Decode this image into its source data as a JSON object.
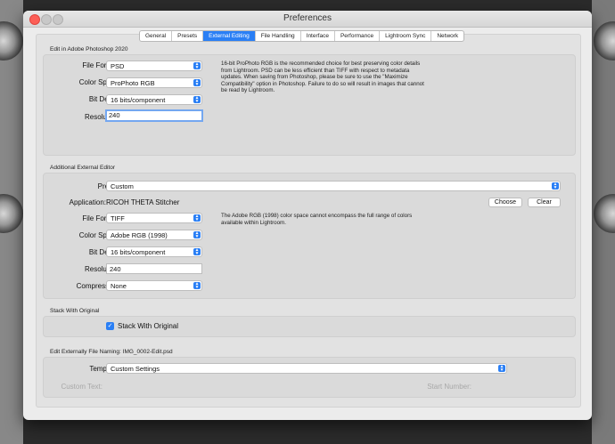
{
  "window": {
    "title": "Preferences"
  },
  "tabs": [
    {
      "label": "General"
    },
    {
      "label": "Presets"
    },
    {
      "label": "External Editing"
    },
    {
      "label": "File Handling"
    },
    {
      "label": "Interface"
    },
    {
      "label": "Performance"
    },
    {
      "label": "Lightroom Sync"
    },
    {
      "label": "Network"
    }
  ],
  "photoshop": {
    "title": "Edit in Adobe Photoshop 2020",
    "file_format_label": "File Format:",
    "file_format": "PSD",
    "color_space_label": "Color Space:",
    "color_space": "ProPhoto RGB",
    "bit_depth_label": "Bit Depth:",
    "bit_depth": "16 bits/component",
    "resolution_label": "Resolution:",
    "resolution": "240",
    "note": "16-bit ProPhoto RGB is the recommended choice for best preserving color details from Lightroom. PSD can be less efficient than TIFF with respect to metadata updates. When saving from Photoshop, please be sure to use the \"Maximize Compatibility\" option in Photoshop. Failure to do so will result in images that cannot be read by Lightroom."
  },
  "external": {
    "title": "Additional External Editor",
    "preset_label": "Preset:",
    "preset": "Custom",
    "application_label": "Application:",
    "application": "RICOH THETA Stitcher",
    "choose_label": "Choose",
    "clear_label": "Clear",
    "file_format_label": "File Format:",
    "file_format": "TIFF",
    "color_space_label": "Color Space:",
    "color_space": "Adobe RGB (1998)",
    "bit_depth_label": "Bit Depth:",
    "bit_depth": "16 bits/component",
    "resolution_label": "Resolution:",
    "resolution": "240",
    "compression_label": "Compression:",
    "compression": "None",
    "note": "The Adobe RGB (1998) color space cannot encompass the full range of colors available within Lightroom."
  },
  "stack": {
    "title": "Stack With Original",
    "checkbox_label": "Stack With Original",
    "checked": true
  },
  "naming": {
    "title": "Edit Externally File Naming:",
    "example": "IMG_0002-Edit.psd",
    "template_label": "Template:",
    "template": "Custom Settings",
    "custom_text_label": "Custom Text:",
    "start_number_label": "Start Number:"
  },
  "colors": {
    "accent": "#2a7ff5",
    "close": "#fd5f57"
  }
}
